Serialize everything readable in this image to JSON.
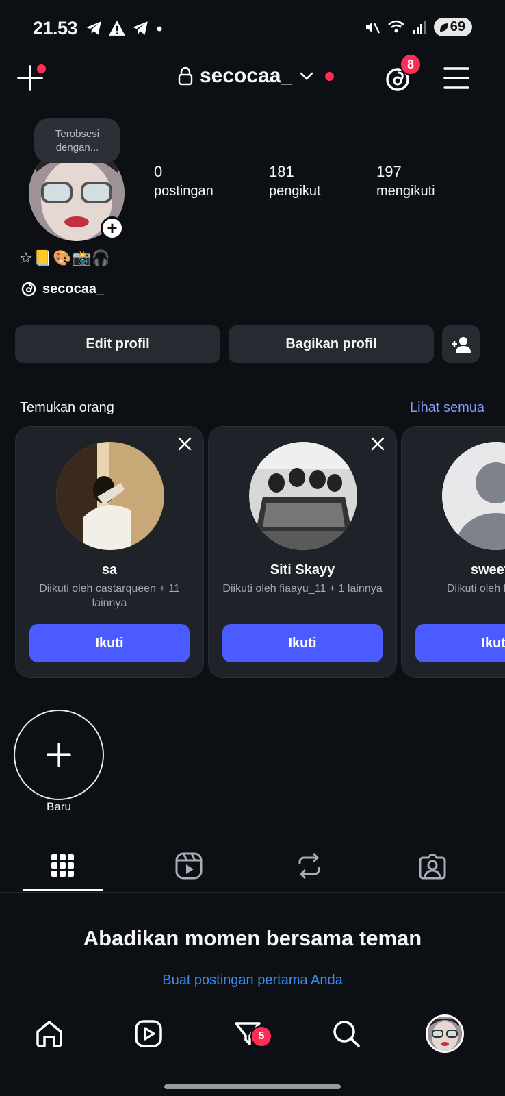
{
  "status_bar": {
    "time": "21.53",
    "battery": "69",
    "signal_label": "5"
  },
  "header": {
    "username": "secocaa_",
    "threads_badge": "8"
  },
  "profile": {
    "note": "Terobsesi dengan...",
    "stats": [
      {
        "value": "0",
        "label": "postingan"
      },
      {
        "value": "181",
        "label": "pengikut"
      },
      {
        "value": "197",
        "label": "mengikuti"
      }
    ],
    "bio": "☆📒🎨📸🎧",
    "threads_handle": "secocaa_",
    "edit_label": "Edit profil",
    "share_label": "Bagikan profil"
  },
  "discover": {
    "title": "Temukan orang",
    "see_all": "Lihat semua",
    "cards": [
      {
        "name": "sa",
        "sub": "Diikuti oleh castarqueen + 11 lainnya",
        "follow": "Ikuti"
      },
      {
        "name": "Siti Skayy",
        "sub": "Diikuti oleh fiaayu_11 + 1 lainnya",
        "follow": "Ikuti"
      },
      {
        "name": "sweetie",
        "sub": "Diikuti oleh f lainnya",
        "follow": "Ikuti"
      }
    ]
  },
  "highlights": {
    "new_label": "Baru"
  },
  "empty_state": {
    "title": "Abadikan momen bersama teman",
    "link": "Buat postingan pertama Anda"
  },
  "bottom_nav": {
    "messages_badge": "5"
  },
  "colors": {
    "background": "#0c0f14",
    "accent_blue": "#4a5cff",
    "link_blue": "#3a8df0",
    "badge_red": "#ff2d55"
  }
}
